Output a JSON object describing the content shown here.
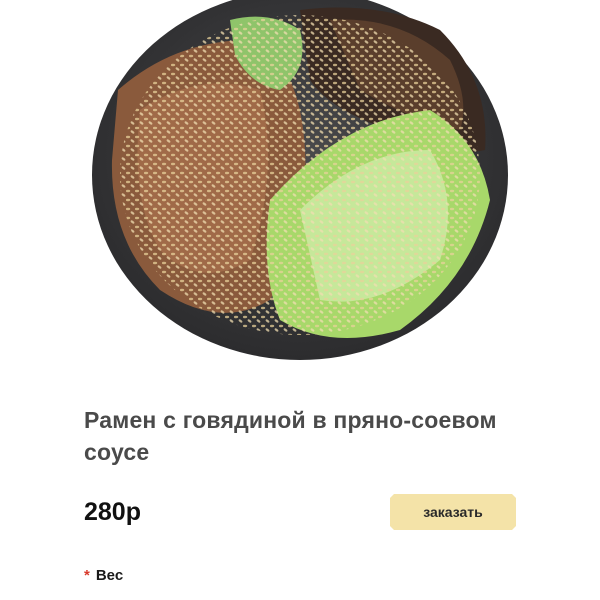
{
  "product": {
    "title": "Рамен с говядиной в пряно-соевом соусе",
    "price": "280р",
    "order_label": "заказать",
    "required_mark": "*",
    "weight_label": "Вес",
    "image_alt": "bowl-with-beef-sesame-cabbage-mushrooms"
  },
  "colors": {
    "button_bg": "#f4e3a8",
    "required_star": "#d8392b",
    "title_text": "#4a4a4a"
  }
}
